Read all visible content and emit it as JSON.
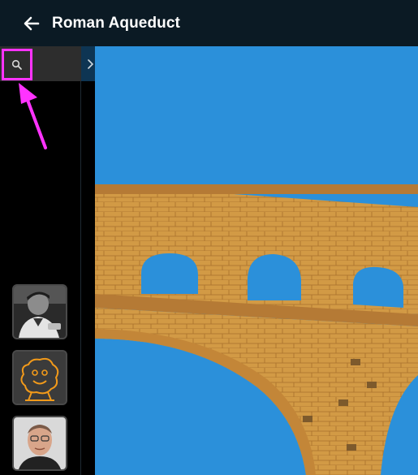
{
  "header": {
    "title": "Roman Aqueduct",
    "back_icon": "arrow-left-icon"
  },
  "sidebar": {
    "search_icon": "search-icon",
    "expand_icon": "chevron-right-icon",
    "avatars": [
      {
        "icon": "avatar-photo-man-bw"
      },
      {
        "icon": "avatar-drawing-face"
      },
      {
        "icon": "avatar-photo-man-glasses"
      }
    ]
  },
  "main": {
    "image_subject": "aqueduct-photo"
  },
  "colors": {
    "header_bg": "#0b1a24",
    "highlight": "#ff33ff",
    "sky": "#2b90da",
    "stone": "#d29a45"
  }
}
